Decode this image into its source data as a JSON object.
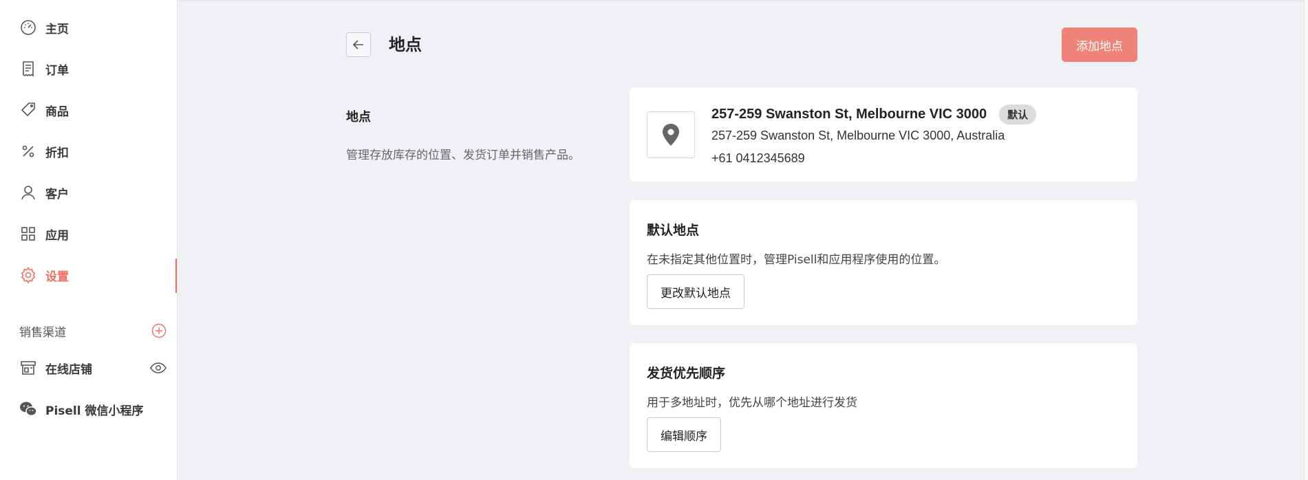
{
  "sidebar": {
    "items": [
      {
        "label": "主页",
        "icon": "dashboard-icon"
      },
      {
        "label": "订单",
        "icon": "receipt-icon"
      },
      {
        "label": "商品",
        "icon": "tag-icon"
      },
      {
        "label": "折扣",
        "icon": "percent-icon"
      },
      {
        "label": "客户",
        "icon": "user-icon"
      },
      {
        "label": "应用",
        "icon": "apps-grid-icon"
      },
      {
        "label": "设置",
        "icon": "gear-icon",
        "active": true
      }
    ],
    "sales_channels": {
      "label": "销售渠道",
      "items": [
        {
          "label": "在线店铺",
          "icon": "store-icon"
        },
        {
          "label": "Pisell 微信小程序",
          "icon": "wechat-icon"
        }
      ]
    }
  },
  "header": {
    "title": "地点",
    "add_button": "添加地点"
  },
  "description": {
    "title": "地点",
    "text": "管理存放库存的位置、发货订单并销售产品。"
  },
  "location_card": {
    "name": "257-259 Swanston St, Melbourne VIC 3000",
    "badge": "默认",
    "address": "257-259 Swanston St, Melbourne VIC 3000, Australia",
    "phone": "+61 0412345689"
  },
  "default_location_card": {
    "title": "默认地点",
    "text": "在未指定其他位置时，管理Pisell和应用程序使用的位置。",
    "button": "更改默认地点"
  },
  "shipping_priority_card": {
    "title": "发货优先顺序",
    "text": "用于多地址时，优先从哪个地址进行发货",
    "button": "编辑顺序"
  },
  "colors": {
    "accent": "#ef6f63",
    "add_button_bg": "#ef837a",
    "page_bg": "#f0f1f5"
  }
}
